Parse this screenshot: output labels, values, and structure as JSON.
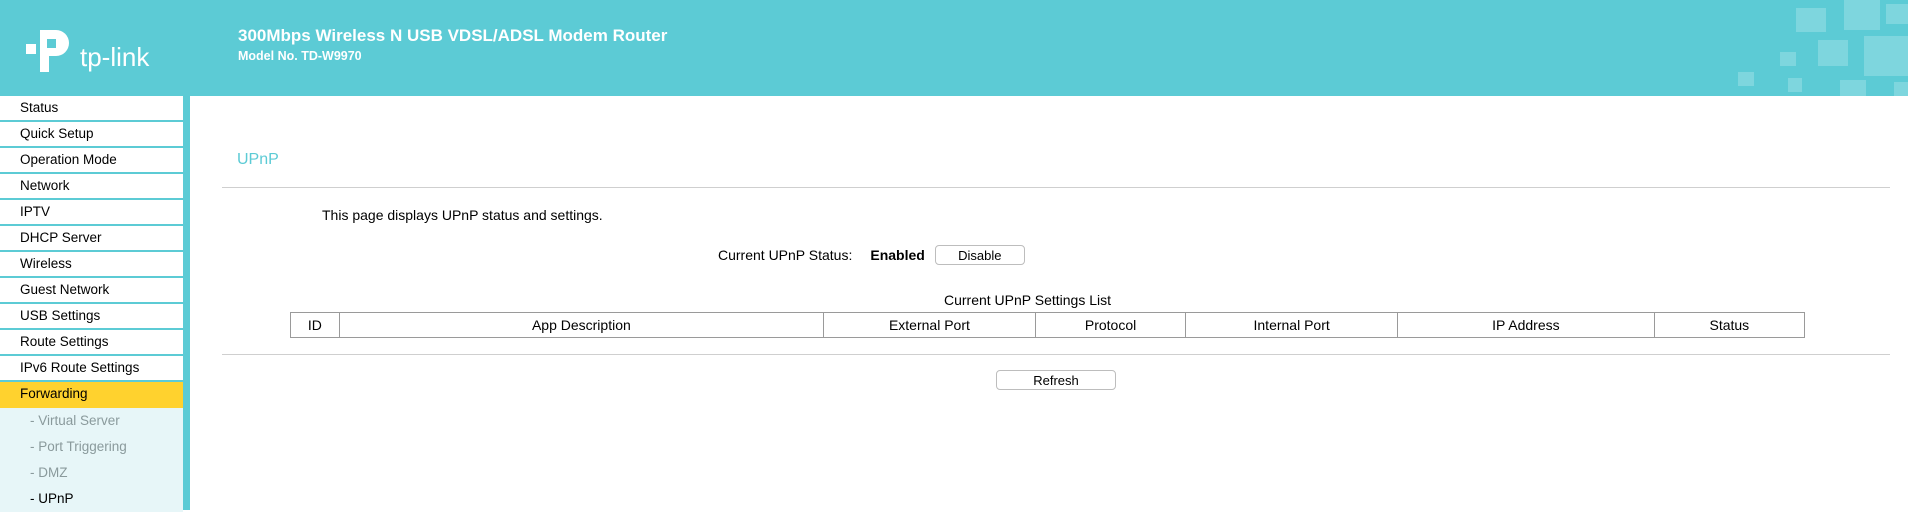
{
  "header": {
    "brand": "tp-link",
    "product_title": "300Mbps Wireless N USB VDSL/ADSL Modem Router",
    "model": "Model No. TD-W9970"
  },
  "sidebar": {
    "items": [
      {
        "label": "Status"
      },
      {
        "label": "Quick Setup"
      },
      {
        "label": "Operation Mode"
      },
      {
        "label": "Network"
      },
      {
        "label": "IPTV"
      },
      {
        "label": "DHCP Server"
      },
      {
        "label": "Wireless"
      },
      {
        "label": "Guest Network"
      },
      {
        "label": "USB Settings"
      },
      {
        "label": "Route Settings"
      },
      {
        "label": "IPv6 Route Settings"
      },
      {
        "label": "Forwarding"
      }
    ],
    "subitems": [
      {
        "label": "- Virtual Server"
      },
      {
        "label": "- Port Triggering"
      },
      {
        "label": "- DMZ"
      },
      {
        "label": "- UPnP"
      }
    ]
  },
  "main": {
    "title": "UPnP",
    "description": "This page displays UPnP status and settings.",
    "status_label": "Current UPnP Status:",
    "status_value": "Enabled",
    "disable_label": "Disable",
    "list_caption": "Current UPnP Settings List",
    "columns": [
      "ID",
      "App Description",
      "External Port",
      "Protocol",
      "Internal Port",
      "IP Address",
      "Status"
    ],
    "refresh_label": "Refresh"
  },
  "colors": {
    "brand": "#5ccbd5",
    "active": "#ffd22e",
    "submenu_bg": "#e7f6f8"
  }
}
